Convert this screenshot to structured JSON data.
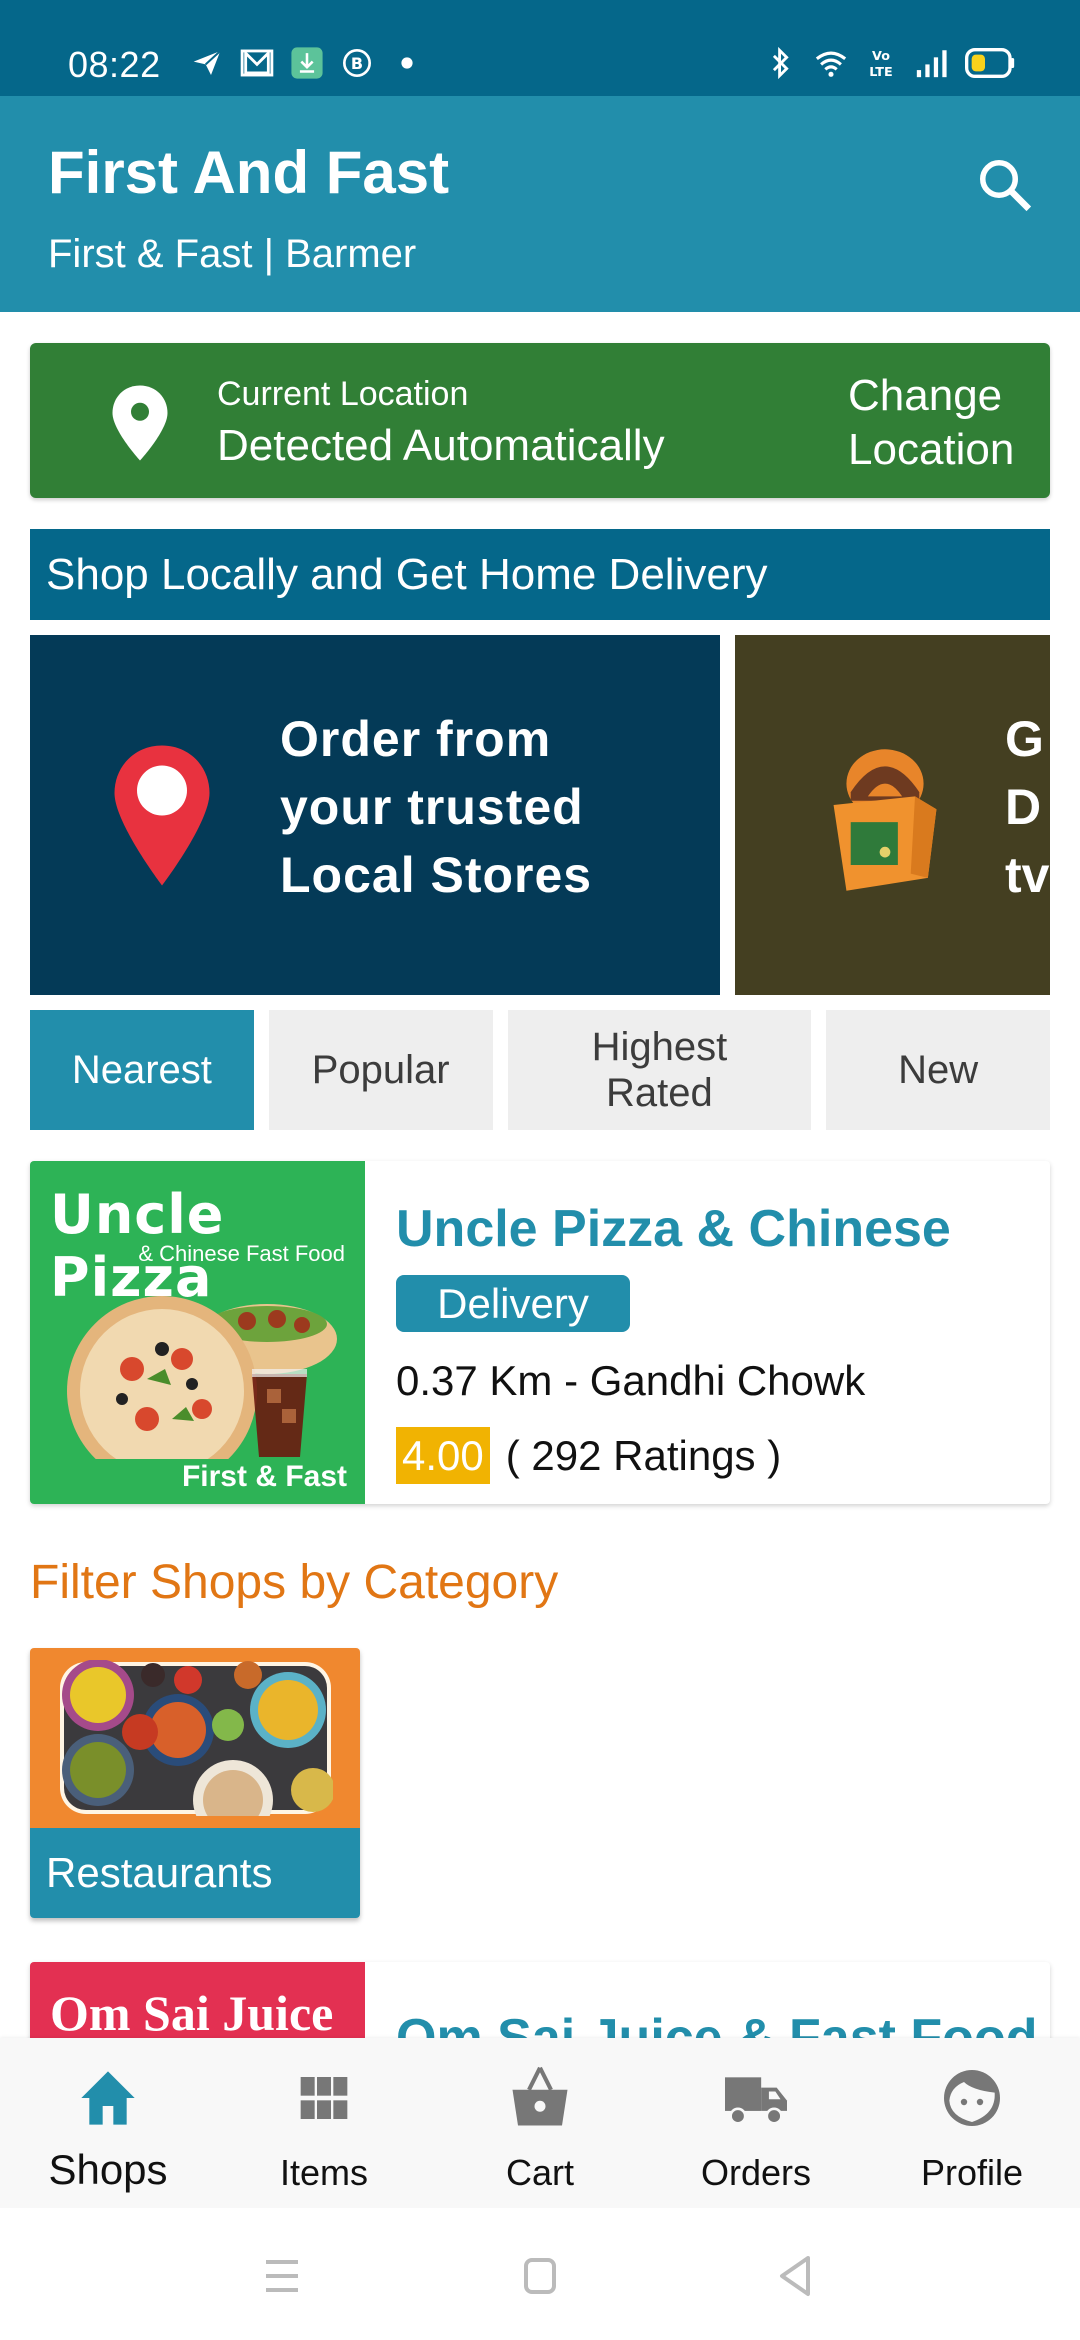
{
  "status_bar": {
    "time": "08:22",
    "left_icons": [
      "telegram-icon",
      "gmail-icon",
      "download-icon",
      "business-chat-icon",
      "dot-icon"
    ],
    "right_icons": [
      "bluetooth-icon",
      "wifi-icon",
      "volte-icon",
      "signal-icon",
      "battery-icon"
    ]
  },
  "app_bar": {
    "title": "First And Fast",
    "subtitle": "First & Fast | Barmer",
    "search_icon": "search-icon"
  },
  "location": {
    "label": "Current Location",
    "value": "Detected Automatically",
    "change_label": "Change Location"
  },
  "banner_header": "Shop Locally and Get Home Delivery",
  "carousel": {
    "slides": [
      {
        "text": [
          "Order from",
          "your trusted",
          "Local Stores"
        ],
        "bg": "#043a57"
      },
      {
        "text": [
          "G",
          "D",
          "tv"
        ],
        "bg": "#443f21"
      }
    ]
  },
  "sort_tabs": [
    {
      "label": "Nearest",
      "active": true
    },
    {
      "label": "Popular",
      "active": false
    },
    {
      "label": "Highest Rated",
      "active": false
    },
    {
      "label": "New",
      "active": false
    }
  ],
  "shops": [
    {
      "name": "Uncle Pizza & Chinese",
      "image_title": "Uncle Pizza",
      "image_subtitle": "& Chinese Fast Food",
      "image_footer": "First & Fast",
      "badge": "Delivery",
      "distance": "0.37 Km - Gandhi Chowk",
      "rating": "4.00",
      "ratings_count": "( 292 Ratings )"
    },
    {
      "name": "Om Sai Juice & Fast Food",
      "image_title": "Om Sai Juice"
    }
  ],
  "category_section": {
    "title": "Filter Shops by Category",
    "categories": [
      {
        "label": "Restaurants"
      }
    ]
  },
  "bottom_nav": [
    {
      "label": "Shops",
      "icon": "home-icon",
      "active": true
    },
    {
      "label": "Items",
      "icon": "grid-icon",
      "active": false
    },
    {
      "label": "Cart",
      "icon": "basket-icon",
      "active": false
    },
    {
      "label": "Orders",
      "icon": "truck-icon",
      "active": false
    },
    {
      "label": "Profile",
      "icon": "face-icon",
      "active": false
    }
  ],
  "colors": {
    "status_bar": "#05678a",
    "primary": "#228eab",
    "location_green": "#317f36",
    "rating_yellow": "#f1b302",
    "category_orange": "#e17614",
    "pizza_green": "#2db356",
    "juice_red": "#e33052"
  }
}
